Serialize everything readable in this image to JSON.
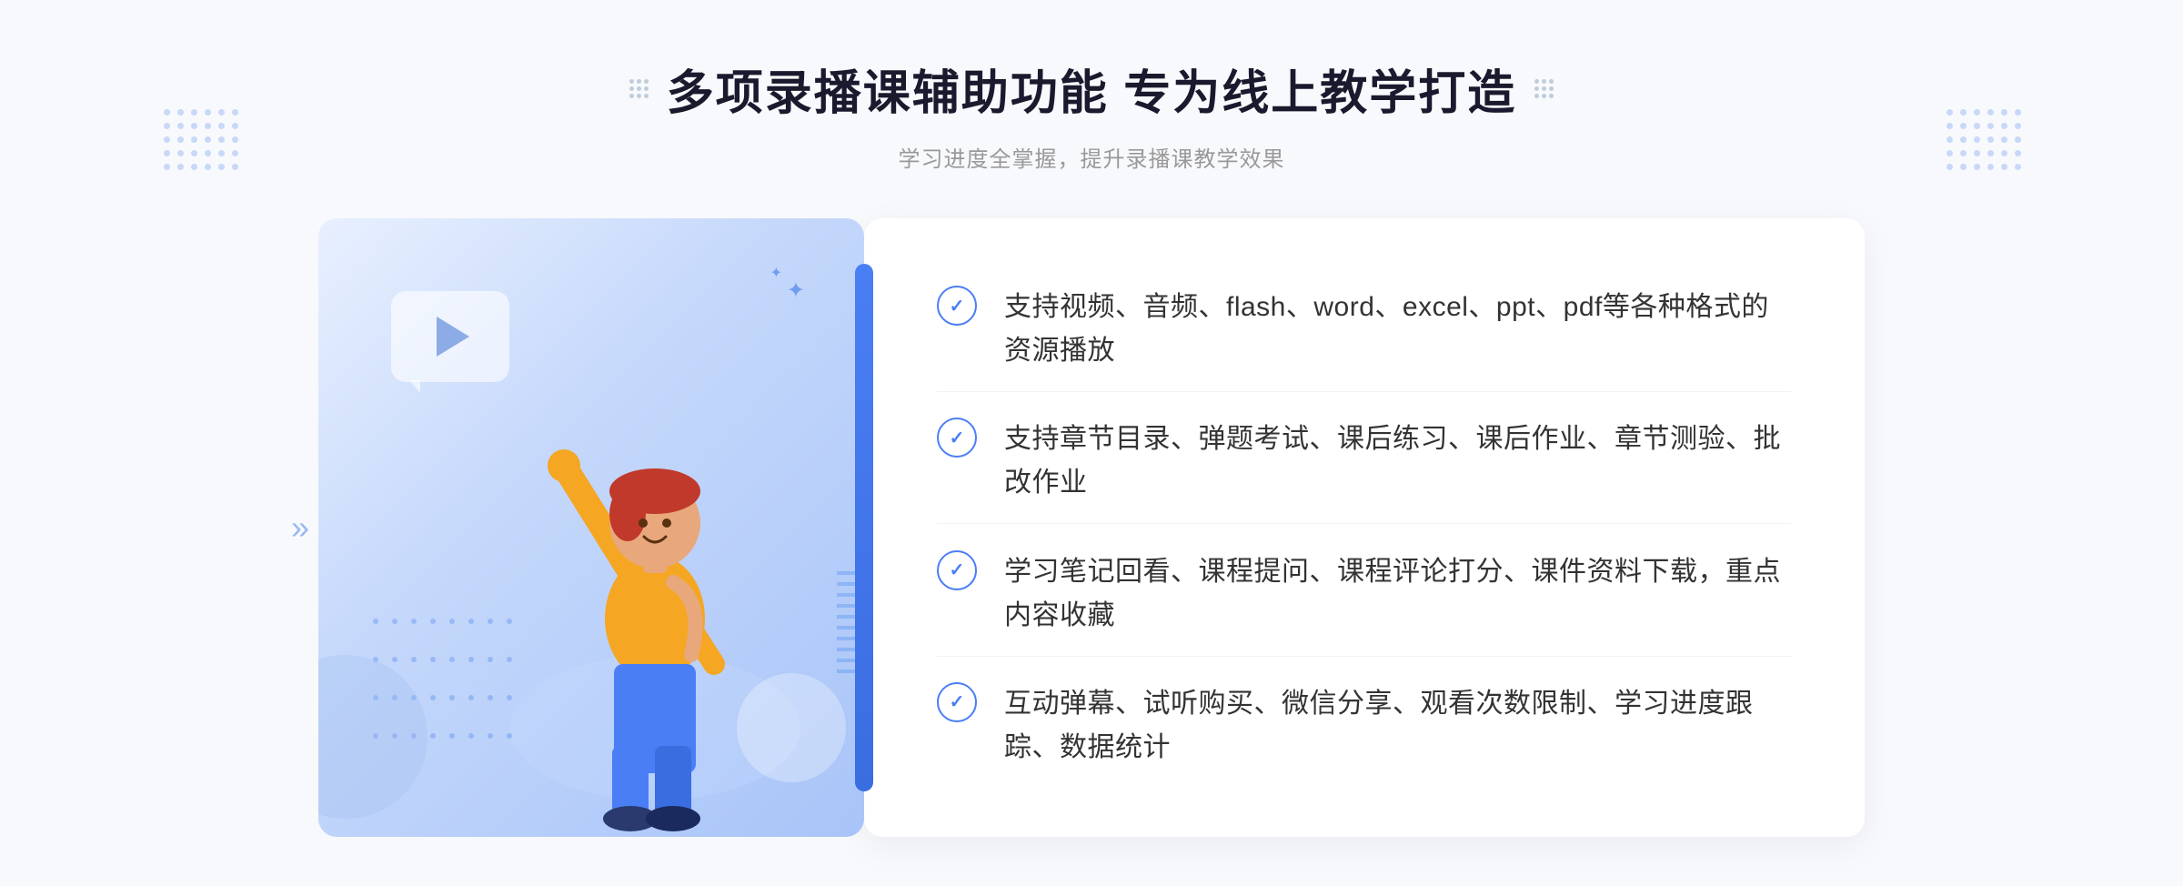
{
  "header": {
    "title": "多项录播课辅助功能 专为线上教学打造",
    "subtitle": "学习进度全掌握，提升录播课教学效果"
  },
  "features": [
    {
      "id": "feature-1",
      "text": "支持视频、音频、flash、word、excel、ppt、pdf等各种格式的资源播放"
    },
    {
      "id": "feature-2",
      "text": "支持章节目录、弹题考试、课后练习、课后作业、章节测验、批改作业"
    },
    {
      "id": "feature-3",
      "text": "学习笔记回看、课程提问、课程评论打分、课件资料下载，重点内容收藏"
    },
    {
      "id": "feature-4",
      "text": "互动弹幕、试听购买、微信分享、观看次数限制、学习进度跟踪、数据统计"
    }
  ],
  "colors": {
    "primary": "#4a7ef5",
    "title": "#1a1a2e",
    "text": "#333333",
    "subtitle": "#999999",
    "check": "#4a7ef5"
  },
  "icons": {
    "play": "▶",
    "check": "✓",
    "chevron": "»",
    "sparkle": "✦"
  }
}
